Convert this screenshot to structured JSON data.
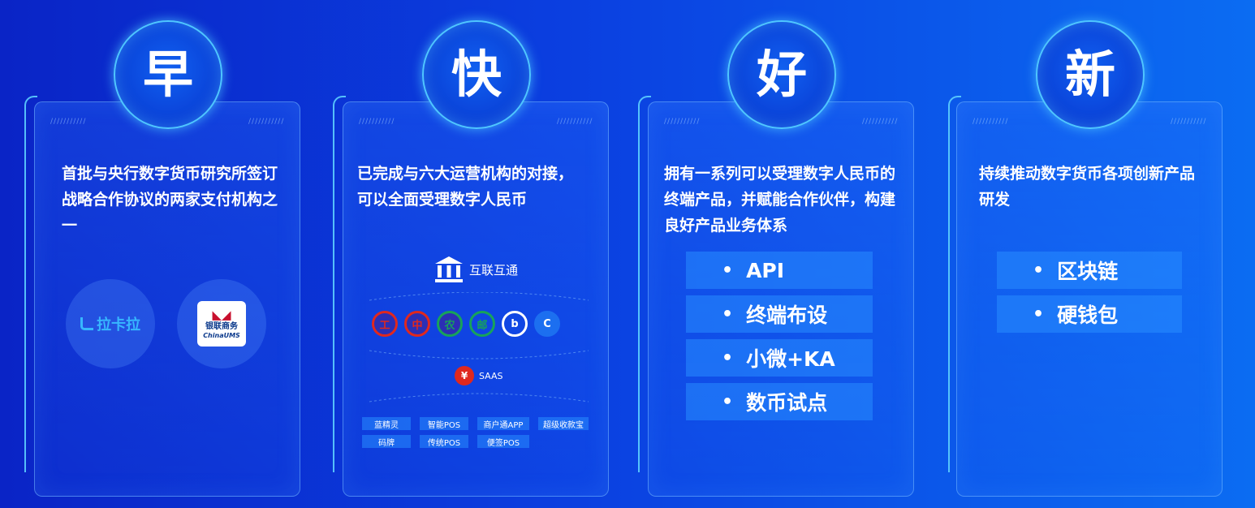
{
  "cards": [
    {
      "heading": "早",
      "text": "首批与央行数字货币研究所签订战略合作协议的两家支付机构之一",
      "logos": [
        {
          "label": "拉卡拉",
          "icon": "lakala-logo"
        },
        {
          "label": "银联商务",
          "sub": "ChinaUMS",
          "icon": "chinaums-logo"
        }
      ]
    },
    {
      "heading": "快",
      "text": "已完成与六大运营机构的对接，可以全面受理数字人民币",
      "diagram": {
        "top_label": "互联互通",
        "banks": [
          {
            "icon": "icbc-logo",
            "color": "#e0281e",
            "glyph": "工"
          },
          {
            "icon": "boc-logo",
            "color": "#e0281e",
            "glyph": "中"
          },
          {
            "icon": "abc-logo",
            "color": "#17a35a",
            "glyph": "农"
          },
          {
            "icon": "postal-bank-logo",
            "color": "#17a35a",
            "glyph": "邮"
          },
          {
            "icon": "bocom-logo",
            "color": "#ffffff",
            "glyph": "b"
          },
          {
            "icon": "ccb-logo",
            "color": "#1c6ff0",
            "glyph": "C"
          }
        ],
        "middle_label": "SAAS",
        "tags": [
          "蓝精灵",
          "智能POS",
          "商户通APP",
          "超级收款宝",
          "码牌",
          "传统POS",
          "便签POS"
        ]
      }
    },
    {
      "heading": "好",
      "text": "拥有一系列可以受理数字人民币的终端产品，并赋能合作伙伴，构建良好产品业务体系",
      "items": [
        "API",
        "终端布设",
        "小微+KA",
        "数币试点"
      ]
    },
    {
      "heading": "新",
      "text": "持续推动数字货币各项创新产品研发",
      "items": [
        "区块链",
        "硬钱包"
      ]
    }
  ],
  "colors": {
    "accent_line": "#5ed0ff",
    "list_bg": "#288cff",
    "lakala_blue": "#37b7ff"
  }
}
